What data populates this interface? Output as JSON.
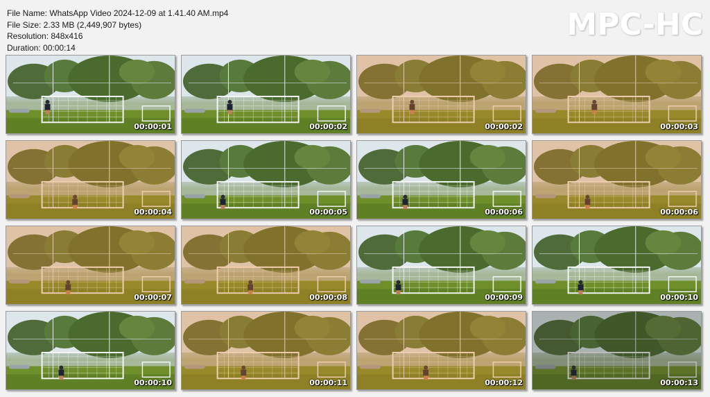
{
  "info": {
    "file_name": "File Name: WhatsApp Video 2024-12-09 at 1.41.40 AM.mp4",
    "file_size": "File Size: 2.33 MB (2,449,907 bytes)",
    "resolution": "Resolution: 848x416",
    "duration": "Duration: 00:00:14"
  },
  "logo": "MPC-HC",
  "thumbnails": [
    {
      "time": "00:00:01",
      "tint": "green"
    },
    {
      "time": "00:00:02",
      "tint": "green"
    },
    {
      "time": "00:00:02",
      "tint": "warm"
    },
    {
      "time": "00:00:03",
      "tint": "warm"
    },
    {
      "time": "00:00:04",
      "tint": "warm"
    },
    {
      "time": "00:00:05",
      "tint": "green"
    },
    {
      "time": "00:00:06",
      "tint": "green"
    },
    {
      "time": "00:00:06",
      "tint": "warm"
    },
    {
      "time": "00:00:07",
      "tint": "warm"
    },
    {
      "time": "00:00:08",
      "tint": "warm"
    },
    {
      "time": "00:00:09",
      "tint": "green"
    },
    {
      "time": "00:00:10",
      "tint": "green"
    },
    {
      "time": "00:00:10",
      "tint": "green"
    },
    {
      "time": "00:00:11",
      "tint": "warm"
    },
    {
      "time": "00:00:12",
      "tint": "warm"
    },
    {
      "time": "00:00:13",
      "tint": "dark"
    }
  ]
}
